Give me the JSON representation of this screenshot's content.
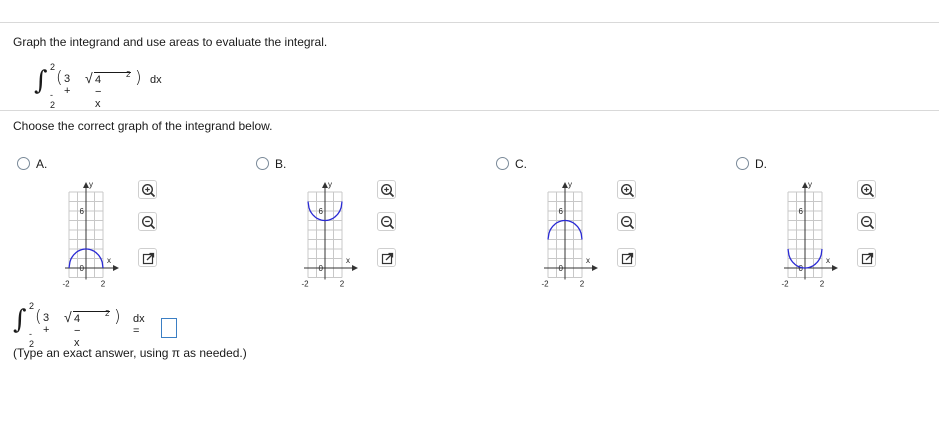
{
  "question": {
    "prompt": "Graph the integrand and use areas to evaluate the integral.",
    "integral": {
      "upper": "2",
      "lower": "- 2",
      "integrand_left": "3 +",
      "integrand_radicand": "4 − x",
      "exponent": "2",
      "differential": "dx"
    },
    "graph_instruction": "Choose the correct graph of the integrand below."
  },
  "options": [
    {
      "letter": "A.",
      "curve": "upper-semicircle-low",
      "selected": false
    },
    {
      "letter": "B.",
      "curve": "lower-semicircle-high",
      "selected": false
    },
    {
      "letter": "C.",
      "curve": "upper-semicircle-high",
      "selected": false
    },
    {
      "letter": "D.",
      "curve": "lower-semicircle-low",
      "selected": false
    }
  ],
  "graph_labels": {
    "y_axis": "y",
    "x_axis": "x",
    "y_tick_top": "6",
    "y_tick_zero": "0",
    "x_tick_left": "-2",
    "x_tick_right": "2"
  },
  "tools": [
    "zoom-in-icon",
    "zoom-out-icon",
    "expand-icon"
  ],
  "answer": {
    "equals": "dx =",
    "value": "",
    "hint": "(Type an exact answer, using π as needed.)"
  },
  "colors": {
    "curve": "#2a2ad4",
    "grid": "#c8c8c8",
    "divider": "#d9d9d9",
    "input_border": "#3b7fc4"
  }
}
